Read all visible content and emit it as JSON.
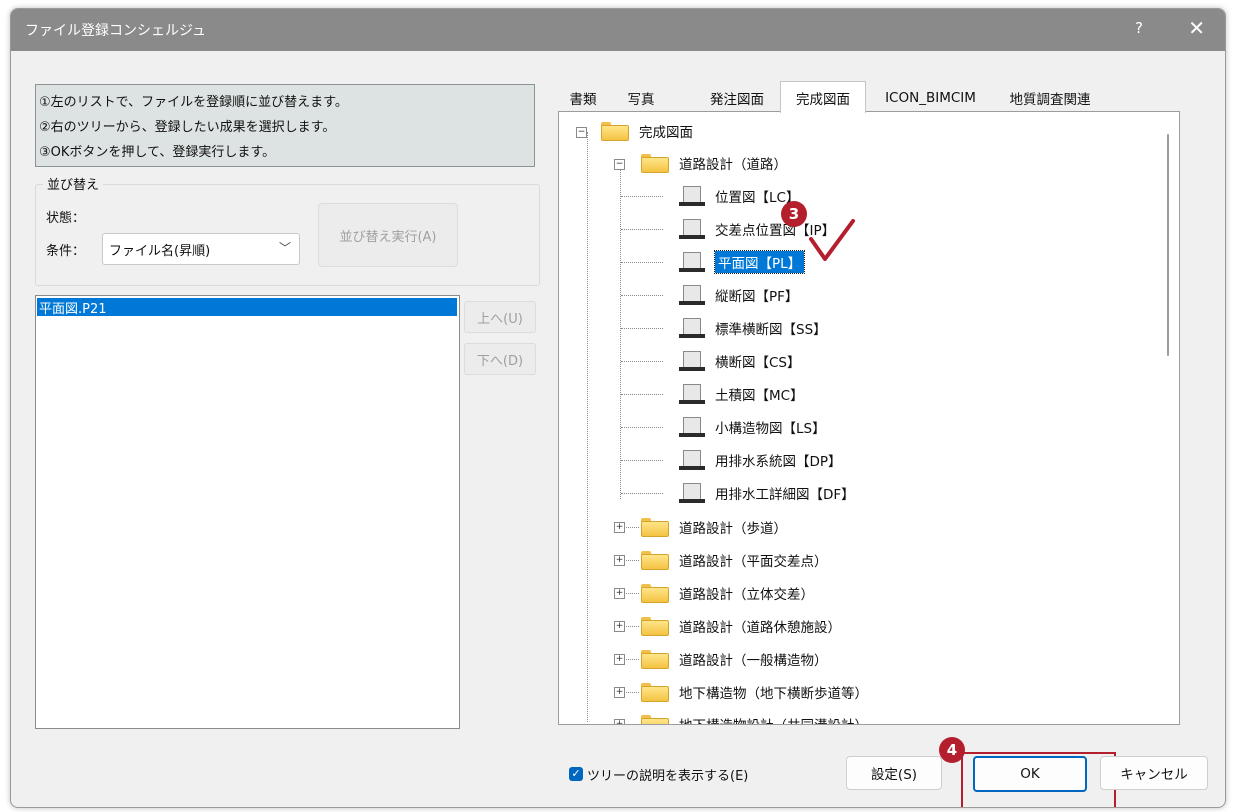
{
  "window": {
    "title": "ファイル登録コンシェルジュ",
    "help": "?",
    "close": "✕"
  },
  "instructions": [
    "①左のリストで、ファイルを登録順に並び替えます。",
    "②右のツリーから、登録したい成果を選択します。",
    "③OKボタンを押して、登録実行します。"
  ],
  "sort": {
    "group_label": "並び替え",
    "status_label": "状態：",
    "condition_label": "条件：",
    "condition_value": "ファイル名(昇順)",
    "execute_button": "並び替え実行(A)"
  },
  "file_list": {
    "items": [
      "平面図.P21"
    ]
  },
  "move": {
    "up": "上へ(U)",
    "down": "下へ(D)"
  },
  "tabs": [
    "書類",
    "写真",
    "発注図面",
    "完成図面",
    "ICON_BIMCIM",
    "地質調査関連"
  ],
  "active_tab": "完成図面",
  "tree": {
    "root": "完成図面",
    "expanded": "道路設計（道路）",
    "children": [
      "位置図【LC】",
      "交差点位置図【IP】",
      "平面図【PL】",
      "縦断図【PF】",
      "標準横断図【SS】",
      "横断図【CS】",
      "土積図【MC】",
      "小構造物図【LS】",
      "用排水系統図【DP】",
      "用排水工詳細図【DF】"
    ],
    "selected": "平面図【PL】",
    "collapsed": [
      "道路設計（歩道）",
      "道路設計（平面交差点）",
      "道路設計（立体交差）",
      "道路設計（道路休憩施設）",
      "道路設計（一般構造物）",
      "地下構造物（地下横断歩道等）",
      "地下構造物設計（共同溝設計）"
    ]
  },
  "footer": {
    "show_description": "ツリーの説明を表示する(E)",
    "settings": "設定(S)",
    "ok": "OK",
    "cancel": "キャンセル"
  },
  "steps": [
    "3",
    "4"
  ],
  "colors": {
    "accent": "#0078d7",
    "annotation": "#b41f2e",
    "titlebar": "#8a8a8a"
  }
}
